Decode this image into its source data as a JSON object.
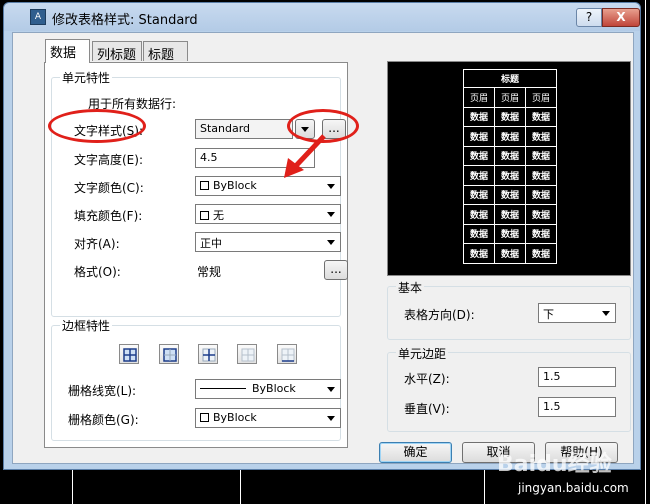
{
  "window": {
    "title": "修改表格样式: Standard",
    "app_icon_glyph": "A",
    "help_glyph": "?",
    "close_glyph": "X"
  },
  "tabs": [
    {
      "label": "数据",
      "active": true
    },
    {
      "label": "列标题",
      "active": false
    },
    {
      "label": "标题",
      "active": false
    }
  ],
  "cell_props": {
    "group_title": "单元特性",
    "applies_label": "用于所有数据行:",
    "text_style_label": "文字样式(S):",
    "text_style_value": "Standard",
    "browse_label": "...",
    "text_height_label": "文字高度(E):",
    "text_height_value": "4.5",
    "text_color_label": "文字颜色(C):",
    "text_color_value": "ByBlock",
    "fill_color_label": "填充颜色(F):",
    "fill_color_value": "无",
    "align_label": "对齐(A):",
    "align_value": "正中",
    "format_label": "格式(O):",
    "format_value": "常规",
    "format_browse_label": "..."
  },
  "border_props": {
    "group_title": "边框特性",
    "buttons": [
      "all-borders",
      "outside-borders",
      "inside-borders",
      "no-borders",
      "bottom-border"
    ],
    "lineweight_label": "栅格线宽(L):",
    "lineweight_value": "ByBlock",
    "grid_color_label": "栅格颜色(G):",
    "grid_color_value": "ByBlock"
  },
  "preview": {
    "title": "标题",
    "header": [
      "页眉",
      "页眉",
      "页眉"
    ],
    "data_cell": "数据",
    "data_rows": 8
  },
  "basic": {
    "group_title": "基本",
    "direction_label": "表格方向(D):",
    "direction_value": "下"
  },
  "margins": {
    "group_title": "单元边距",
    "horizontal_label": "水平(Z):",
    "horizontal_value": "1.5",
    "vertical_label": "垂直(V):",
    "vertical_value": "1.5"
  },
  "footer": {
    "ok_label": "确定",
    "cancel_label": "取消",
    "help_label": "帮助(H)"
  },
  "watermark": {
    "logo": "Baidu经验",
    "url": "jingyan.baidu.com"
  },
  "colors": {
    "annotation_red": "#e0201a",
    "window_frame": "#b9d1ea"
  }
}
